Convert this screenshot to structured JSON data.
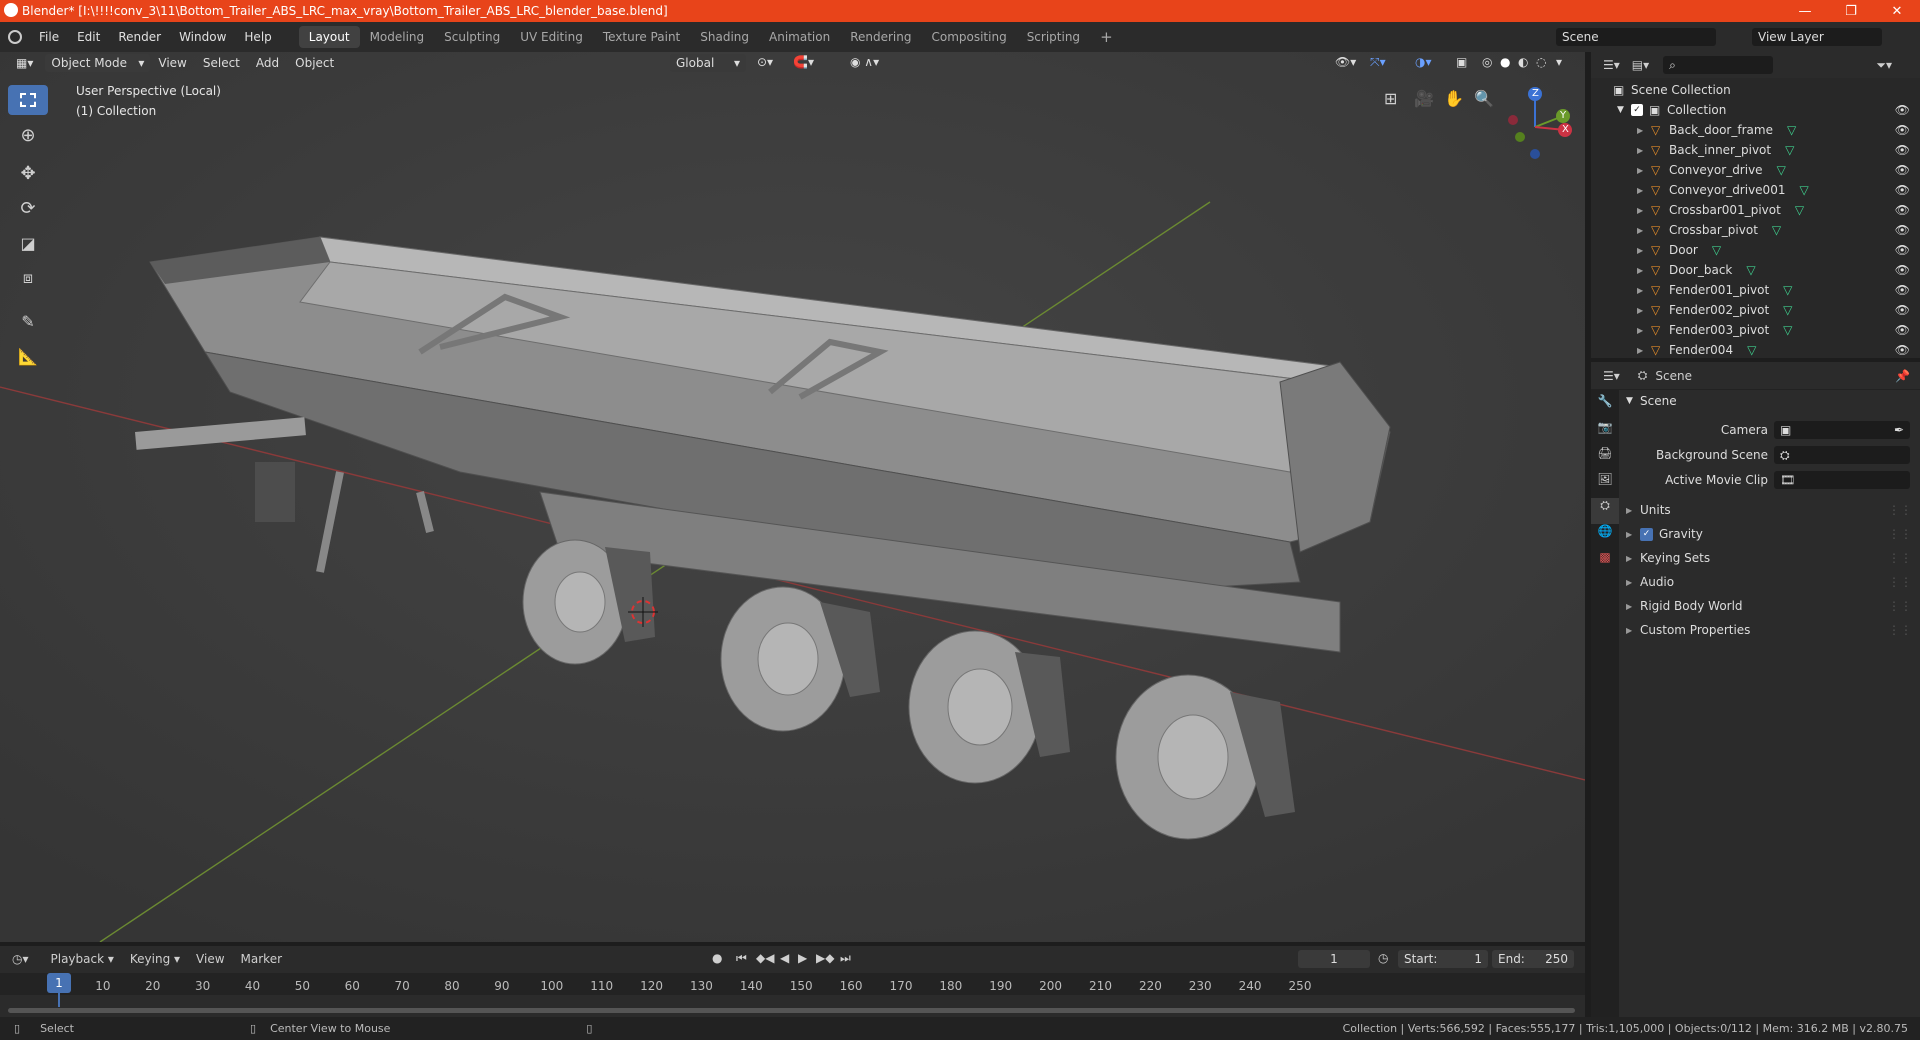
{
  "window": {
    "title": "Blender* [I:\\!!!!conv_3\\11\\Bottom_Trailer_ABS_LRC_max_vray\\Bottom_Trailer_ABS_LRC_blender_base.blend]"
  },
  "menu": [
    "File",
    "Edit",
    "Render",
    "Window",
    "Help"
  ],
  "workspaces": [
    {
      "label": "Layout",
      "active": true
    },
    {
      "label": "Modeling"
    },
    {
      "label": "Sculpting"
    },
    {
      "label": "UV Editing"
    },
    {
      "label": "Texture Paint"
    },
    {
      "label": "Shading"
    },
    {
      "label": "Animation"
    },
    {
      "label": "Rendering"
    },
    {
      "label": "Compositing"
    },
    {
      "label": "Scripting"
    }
  ],
  "scene_selector": {
    "label": "Scene"
  },
  "view_layer": {
    "label": "View Layer"
  },
  "viewport": {
    "mode": "Object Mode",
    "menus": [
      "View",
      "Select",
      "Add",
      "Object"
    ],
    "orientation": "Global",
    "info_line1": "User Perspective (Local)",
    "info_line2": "(1) Collection",
    "gizmo_axes": {
      "x": "X",
      "y": "Y",
      "z": "Z"
    }
  },
  "outliner": {
    "root": "Scene Collection",
    "collection": "Collection",
    "items": [
      "Back_door_frame",
      "Back_inner_pivot",
      "Conveyor_drive",
      "Conveyor_drive001",
      "Crossbar001_pivot",
      "Crossbar_pivot",
      "Door",
      "Door_back",
      "Fender001_pivot",
      "Fender002_pivot",
      "Fender003_pivot",
      "Fender004"
    ]
  },
  "properties": {
    "context": "Scene",
    "panel": "Scene",
    "camera_label": "Camera",
    "bg_scene_label": "Background Scene",
    "movie_clip_label": "Active Movie Clip",
    "sections": [
      "Units",
      "Gravity",
      "Keying Sets",
      "Audio",
      "Rigid Body World",
      "Custom Properties"
    ],
    "gravity_checked": true
  },
  "timeline": {
    "menus": [
      "Playback",
      "Keying",
      "View",
      "Marker"
    ],
    "current_frame": "1",
    "start_label": "Start:",
    "start": "1",
    "end_label": "End:",
    "end": "250",
    "ticks": [
      "1",
      "10",
      "20",
      "30",
      "40",
      "50",
      "60",
      "70",
      "80",
      "90",
      "100",
      "110",
      "120",
      "130",
      "140",
      "150",
      "160",
      "170",
      "180",
      "190",
      "200",
      "210",
      "220",
      "230",
      "240",
      "250"
    ]
  },
  "statusbar": {
    "select": "Select",
    "center_view": "Center View to Mouse",
    "stats": "Collection | Verts:566,592 | Faces:555,177 | Tris:1,105,000 | Objects:0/112 | Mem: 316.2 MB | v2.80.75"
  },
  "colors": {
    "titlebar": "#e8441a",
    "active_tool": "#4772b3",
    "mesh_icon": "#e08a2a",
    "data_icon": "#3fcf8e",
    "x_axis": "#cc3344",
    "y_axis": "#6a9a2a",
    "z_axis": "#3b72d4"
  }
}
